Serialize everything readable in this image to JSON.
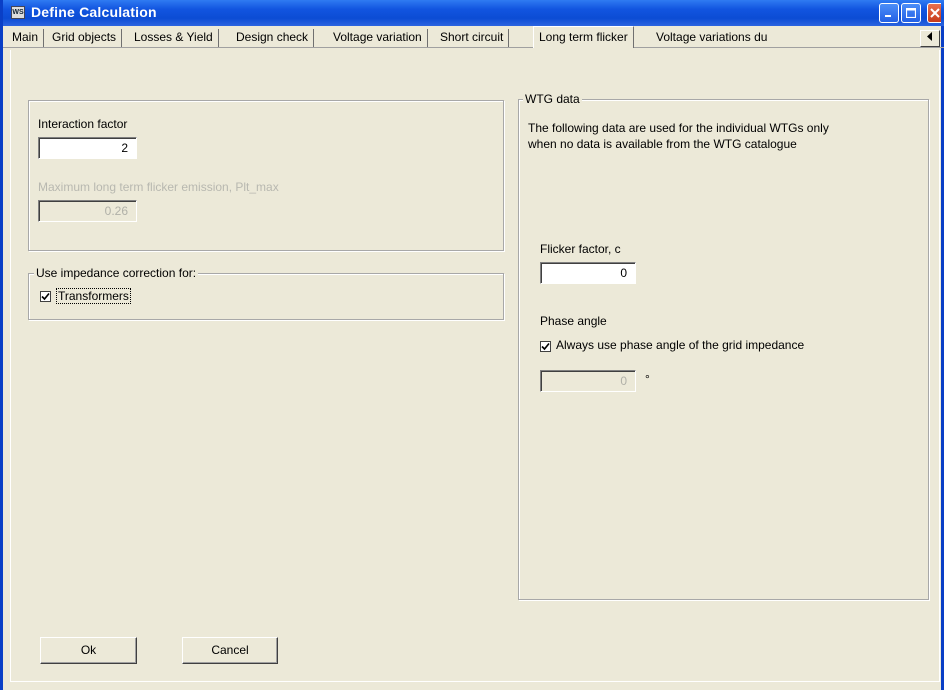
{
  "window": {
    "title": "Define Calculation",
    "app_icon_text": "WS"
  },
  "tabs": [
    {
      "label": "Main",
      "active": false
    },
    {
      "label": "Grid objects",
      "active": false
    },
    {
      "label": "Losses & Yield",
      "active": false
    },
    {
      "label": "Design check",
      "active": false
    },
    {
      "label": "Voltage variation",
      "active": false
    },
    {
      "label": "Short circuit",
      "active": false
    },
    {
      "label": "Long term flicker",
      "active": true
    },
    {
      "label": "Voltage variations du",
      "active": false
    }
  ],
  "tab_scroll_icon": "arrow-left-icon",
  "left": {
    "interaction_factor_label": "Interaction factor",
    "interaction_factor_value": "2",
    "max_flicker_label": "Maximum long term flicker emission, Plt_max",
    "max_flicker_value": "0.26",
    "impedance_group_title": "Use impedance correction for:",
    "transformers_label": "Transformers",
    "transformers_checked": true
  },
  "wtg": {
    "group_title": "WTG data",
    "description_line1": "The following data are used for the individual WTGs only",
    "description_line2": "when no data is available from the WTG catalogue",
    "flicker_factor_label": "Flicker factor, c",
    "flicker_factor_value": "0",
    "phase_angle_label": "Phase angle",
    "always_use_label": "Always use phase angle of the grid impedance",
    "always_use_checked": true,
    "phase_angle_value": "0",
    "phase_angle_unit": "°"
  },
  "buttons": {
    "ok": "Ok",
    "cancel": "Cancel"
  },
  "colors": {
    "titlebar": "#0c4cd4",
    "dialog_bg": "#ece9d8"
  }
}
